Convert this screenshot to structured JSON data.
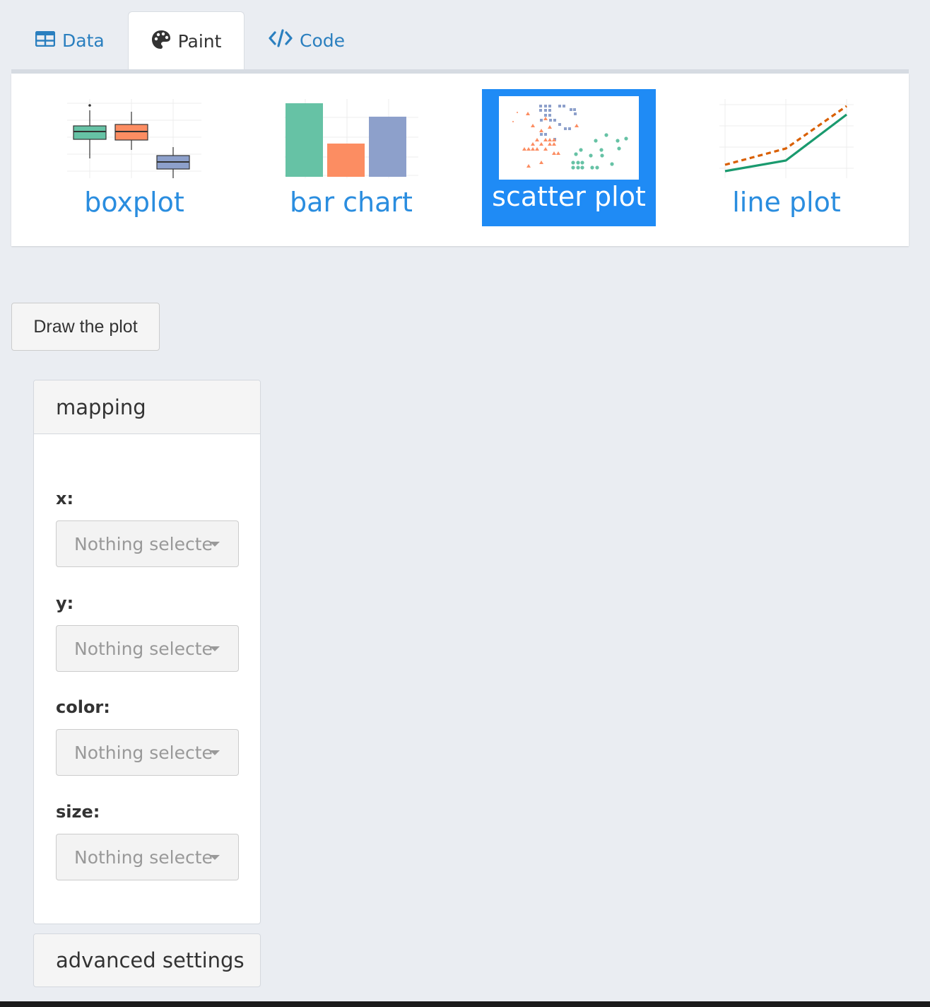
{
  "tabs": [
    {
      "label": "Data",
      "icon": "table-icon",
      "active": false
    },
    {
      "label": "Paint",
      "icon": "palette-icon",
      "active": true
    },
    {
      "label": "Code",
      "icon": "code-icon",
      "active": false
    }
  ],
  "chart_types": [
    {
      "label": "boxplot",
      "selected": false
    },
    {
      "label": "bar chart",
      "selected": false
    },
    {
      "label": "scatter plot",
      "selected": true
    },
    {
      "label": "line plot",
      "selected": false
    }
  ],
  "draw_button": {
    "label": "Draw the plot"
  },
  "mapping": {
    "title": "mapping",
    "fields": [
      {
        "label": "x:",
        "value": "Nothing selecte"
      },
      {
        "label": "y:",
        "value": "Nothing selecte"
      },
      {
        "label": "color:",
        "value": "Nothing selecte"
      },
      {
        "label": "size:",
        "value": "Nothing selecte"
      }
    ]
  },
  "advanced": {
    "title": "advanced settings"
  },
  "colors": {
    "accent": "#1f8bf5",
    "link": "#2a7fbf",
    "green": "#66c2a5",
    "orange": "#fc8d62",
    "purple": "#8da0cb",
    "line_green": "#1a9a6e",
    "line_orange": "#d95f02"
  }
}
